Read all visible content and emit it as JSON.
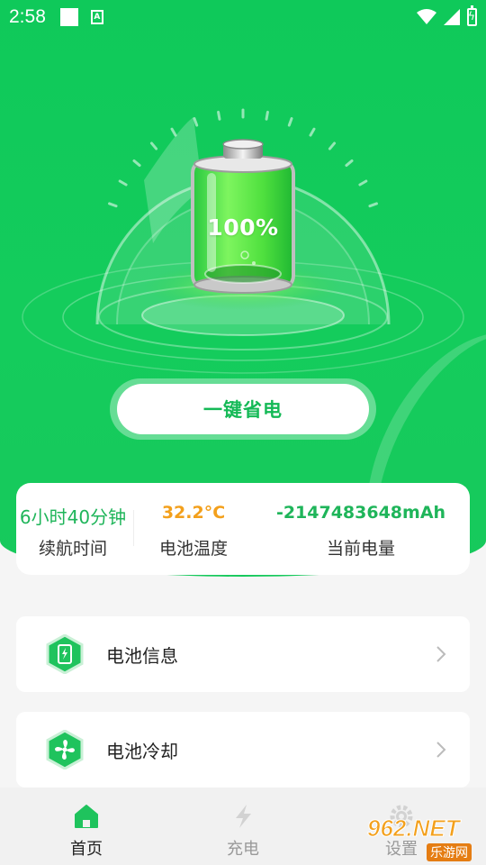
{
  "status_bar": {
    "time": "2:58"
  },
  "battery": {
    "percent_label": "100%",
    "level": 1.0
  },
  "save_button": {
    "label": "一键省电"
  },
  "stats": [
    {
      "value": "6小时40分钟",
      "label": "续航时间"
    },
    {
      "value": "32.2°C",
      "label": "电池温度"
    },
    {
      "value": "-2147483648mAh",
      "label": "当前电量"
    }
  ],
  "features": [
    {
      "title": "电池信息",
      "icon": "battery-info-icon"
    },
    {
      "title": "电池冷却",
      "icon": "fan-icon"
    }
  ],
  "bottom_nav": {
    "items": [
      {
        "label": "首页",
        "icon": "home-icon",
        "active": true
      },
      {
        "label": "充电",
        "icon": "lightning-icon",
        "active": false
      },
      {
        "label": "设置",
        "icon": "gear-icon",
        "active": false
      }
    ]
  },
  "watermark": {
    "main": "962.NET",
    "sub": "乐游网"
  },
  "colors": {
    "primary_green": "#14cc5c",
    "accent_orange": "#f3a01c",
    "text_green": "#1fb55a"
  }
}
